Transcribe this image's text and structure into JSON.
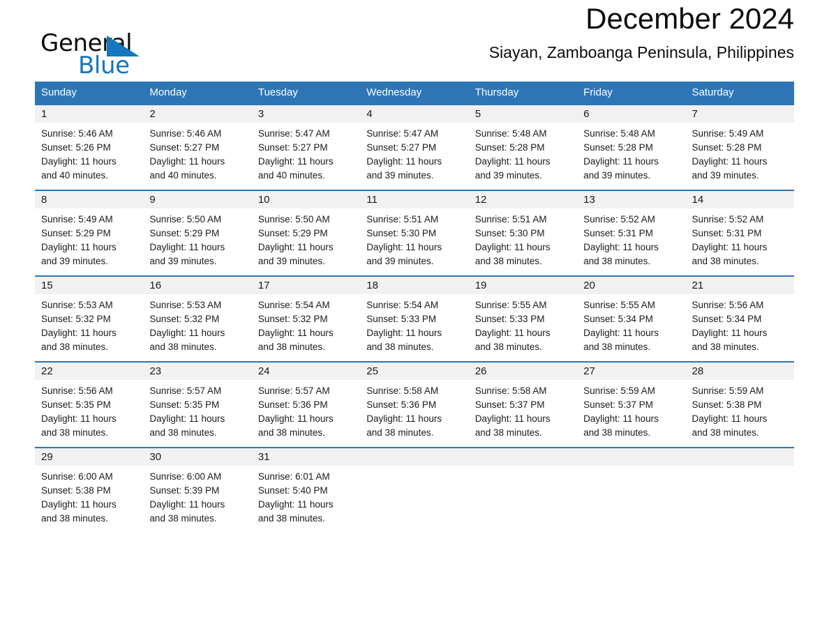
{
  "brand": {
    "name_part1": "General",
    "name_part2": "Blue",
    "accent_color": "#1476bc"
  },
  "header": {
    "title": "December 2024",
    "subtitle": "Siayan, Zamboanga Peninsula, Philippines"
  },
  "theme": {
    "header_blue": "#2e75b6",
    "daynum_band": "#f1f1f1",
    "text": "#1a1a1a"
  },
  "weekdays": [
    "Sunday",
    "Monday",
    "Tuesday",
    "Wednesday",
    "Thursday",
    "Friday",
    "Saturday"
  ],
  "weeks": [
    {
      "days": [
        {
          "num": "1",
          "sunrise": "Sunrise: 5:46 AM",
          "sunset": "Sunset: 5:26 PM",
          "daylight1": "Daylight: 11 hours",
          "daylight2": "and 40 minutes."
        },
        {
          "num": "2",
          "sunrise": "Sunrise: 5:46 AM",
          "sunset": "Sunset: 5:27 PM",
          "daylight1": "Daylight: 11 hours",
          "daylight2": "and 40 minutes."
        },
        {
          "num": "3",
          "sunrise": "Sunrise: 5:47 AM",
          "sunset": "Sunset: 5:27 PM",
          "daylight1": "Daylight: 11 hours",
          "daylight2": "and 40 minutes."
        },
        {
          "num": "4",
          "sunrise": "Sunrise: 5:47 AM",
          "sunset": "Sunset: 5:27 PM",
          "daylight1": "Daylight: 11 hours",
          "daylight2": "and 39 minutes."
        },
        {
          "num": "5",
          "sunrise": "Sunrise: 5:48 AM",
          "sunset": "Sunset: 5:28 PM",
          "daylight1": "Daylight: 11 hours",
          "daylight2": "and 39 minutes."
        },
        {
          "num": "6",
          "sunrise": "Sunrise: 5:48 AM",
          "sunset": "Sunset: 5:28 PM",
          "daylight1": "Daylight: 11 hours",
          "daylight2": "and 39 minutes."
        },
        {
          "num": "7",
          "sunrise": "Sunrise: 5:49 AM",
          "sunset": "Sunset: 5:28 PM",
          "daylight1": "Daylight: 11 hours",
          "daylight2": "and 39 minutes."
        }
      ]
    },
    {
      "days": [
        {
          "num": "8",
          "sunrise": "Sunrise: 5:49 AM",
          "sunset": "Sunset: 5:29 PM",
          "daylight1": "Daylight: 11 hours",
          "daylight2": "and 39 minutes."
        },
        {
          "num": "9",
          "sunrise": "Sunrise: 5:50 AM",
          "sunset": "Sunset: 5:29 PM",
          "daylight1": "Daylight: 11 hours",
          "daylight2": "and 39 minutes."
        },
        {
          "num": "10",
          "sunrise": "Sunrise: 5:50 AM",
          "sunset": "Sunset: 5:29 PM",
          "daylight1": "Daylight: 11 hours",
          "daylight2": "and 39 minutes."
        },
        {
          "num": "11",
          "sunrise": "Sunrise: 5:51 AM",
          "sunset": "Sunset: 5:30 PM",
          "daylight1": "Daylight: 11 hours",
          "daylight2": "and 39 minutes."
        },
        {
          "num": "12",
          "sunrise": "Sunrise: 5:51 AM",
          "sunset": "Sunset: 5:30 PM",
          "daylight1": "Daylight: 11 hours",
          "daylight2": "and 38 minutes."
        },
        {
          "num": "13",
          "sunrise": "Sunrise: 5:52 AM",
          "sunset": "Sunset: 5:31 PM",
          "daylight1": "Daylight: 11 hours",
          "daylight2": "and 38 minutes."
        },
        {
          "num": "14",
          "sunrise": "Sunrise: 5:52 AM",
          "sunset": "Sunset: 5:31 PM",
          "daylight1": "Daylight: 11 hours",
          "daylight2": "and 38 minutes."
        }
      ]
    },
    {
      "days": [
        {
          "num": "15",
          "sunrise": "Sunrise: 5:53 AM",
          "sunset": "Sunset: 5:32 PM",
          "daylight1": "Daylight: 11 hours",
          "daylight2": "and 38 minutes."
        },
        {
          "num": "16",
          "sunrise": "Sunrise: 5:53 AM",
          "sunset": "Sunset: 5:32 PM",
          "daylight1": "Daylight: 11 hours",
          "daylight2": "and 38 minutes."
        },
        {
          "num": "17",
          "sunrise": "Sunrise: 5:54 AM",
          "sunset": "Sunset: 5:32 PM",
          "daylight1": "Daylight: 11 hours",
          "daylight2": "and 38 minutes."
        },
        {
          "num": "18",
          "sunrise": "Sunrise: 5:54 AM",
          "sunset": "Sunset: 5:33 PM",
          "daylight1": "Daylight: 11 hours",
          "daylight2": "and 38 minutes."
        },
        {
          "num": "19",
          "sunrise": "Sunrise: 5:55 AM",
          "sunset": "Sunset: 5:33 PM",
          "daylight1": "Daylight: 11 hours",
          "daylight2": "and 38 minutes."
        },
        {
          "num": "20",
          "sunrise": "Sunrise: 5:55 AM",
          "sunset": "Sunset: 5:34 PM",
          "daylight1": "Daylight: 11 hours",
          "daylight2": "and 38 minutes."
        },
        {
          "num": "21",
          "sunrise": "Sunrise: 5:56 AM",
          "sunset": "Sunset: 5:34 PM",
          "daylight1": "Daylight: 11 hours",
          "daylight2": "and 38 minutes."
        }
      ]
    },
    {
      "days": [
        {
          "num": "22",
          "sunrise": "Sunrise: 5:56 AM",
          "sunset": "Sunset: 5:35 PM",
          "daylight1": "Daylight: 11 hours",
          "daylight2": "and 38 minutes."
        },
        {
          "num": "23",
          "sunrise": "Sunrise: 5:57 AM",
          "sunset": "Sunset: 5:35 PM",
          "daylight1": "Daylight: 11 hours",
          "daylight2": "and 38 minutes."
        },
        {
          "num": "24",
          "sunrise": "Sunrise: 5:57 AM",
          "sunset": "Sunset: 5:36 PM",
          "daylight1": "Daylight: 11 hours",
          "daylight2": "and 38 minutes."
        },
        {
          "num": "25",
          "sunrise": "Sunrise: 5:58 AM",
          "sunset": "Sunset: 5:36 PM",
          "daylight1": "Daylight: 11 hours",
          "daylight2": "and 38 minutes."
        },
        {
          "num": "26",
          "sunrise": "Sunrise: 5:58 AM",
          "sunset": "Sunset: 5:37 PM",
          "daylight1": "Daylight: 11 hours",
          "daylight2": "and 38 minutes."
        },
        {
          "num": "27",
          "sunrise": "Sunrise: 5:59 AM",
          "sunset": "Sunset: 5:37 PM",
          "daylight1": "Daylight: 11 hours",
          "daylight2": "and 38 minutes."
        },
        {
          "num": "28",
          "sunrise": "Sunrise: 5:59 AM",
          "sunset": "Sunset: 5:38 PM",
          "daylight1": "Daylight: 11 hours",
          "daylight2": "and 38 minutes."
        }
      ]
    },
    {
      "days": [
        {
          "num": "29",
          "sunrise": "Sunrise: 6:00 AM",
          "sunset": "Sunset: 5:38 PM",
          "daylight1": "Daylight: 11 hours",
          "daylight2": "and 38 minutes."
        },
        {
          "num": "30",
          "sunrise": "Sunrise: 6:00 AM",
          "sunset": "Sunset: 5:39 PM",
          "daylight1": "Daylight: 11 hours",
          "daylight2": "and 38 minutes."
        },
        {
          "num": "31",
          "sunrise": "Sunrise: 6:01 AM",
          "sunset": "Sunset: 5:40 PM",
          "daylight1": "Daylight: 11 hours",
          "daylight2": "and 38 minutes."
        },
        {
          "num": "",
          "sunrise": "",
          "sunset": "",
          "daylight1": "",
          "daylight2": ""
        },
        {
          "num": "",
          "sunrise": "",
          "sunset": "",
          "daylight1": "",
          "daylight2": ""
        },
        {
          "num": "",
          "sunrise": "",
          "sunset": "",
          "daylight1": "",
          "daylight2": ""
        },
        {
          "num": "",
          "sunrise": "",
          "sunset": "",
          "daylight1": "",
          "daylight2": ""
        }
      ]
    }
  ]
}
